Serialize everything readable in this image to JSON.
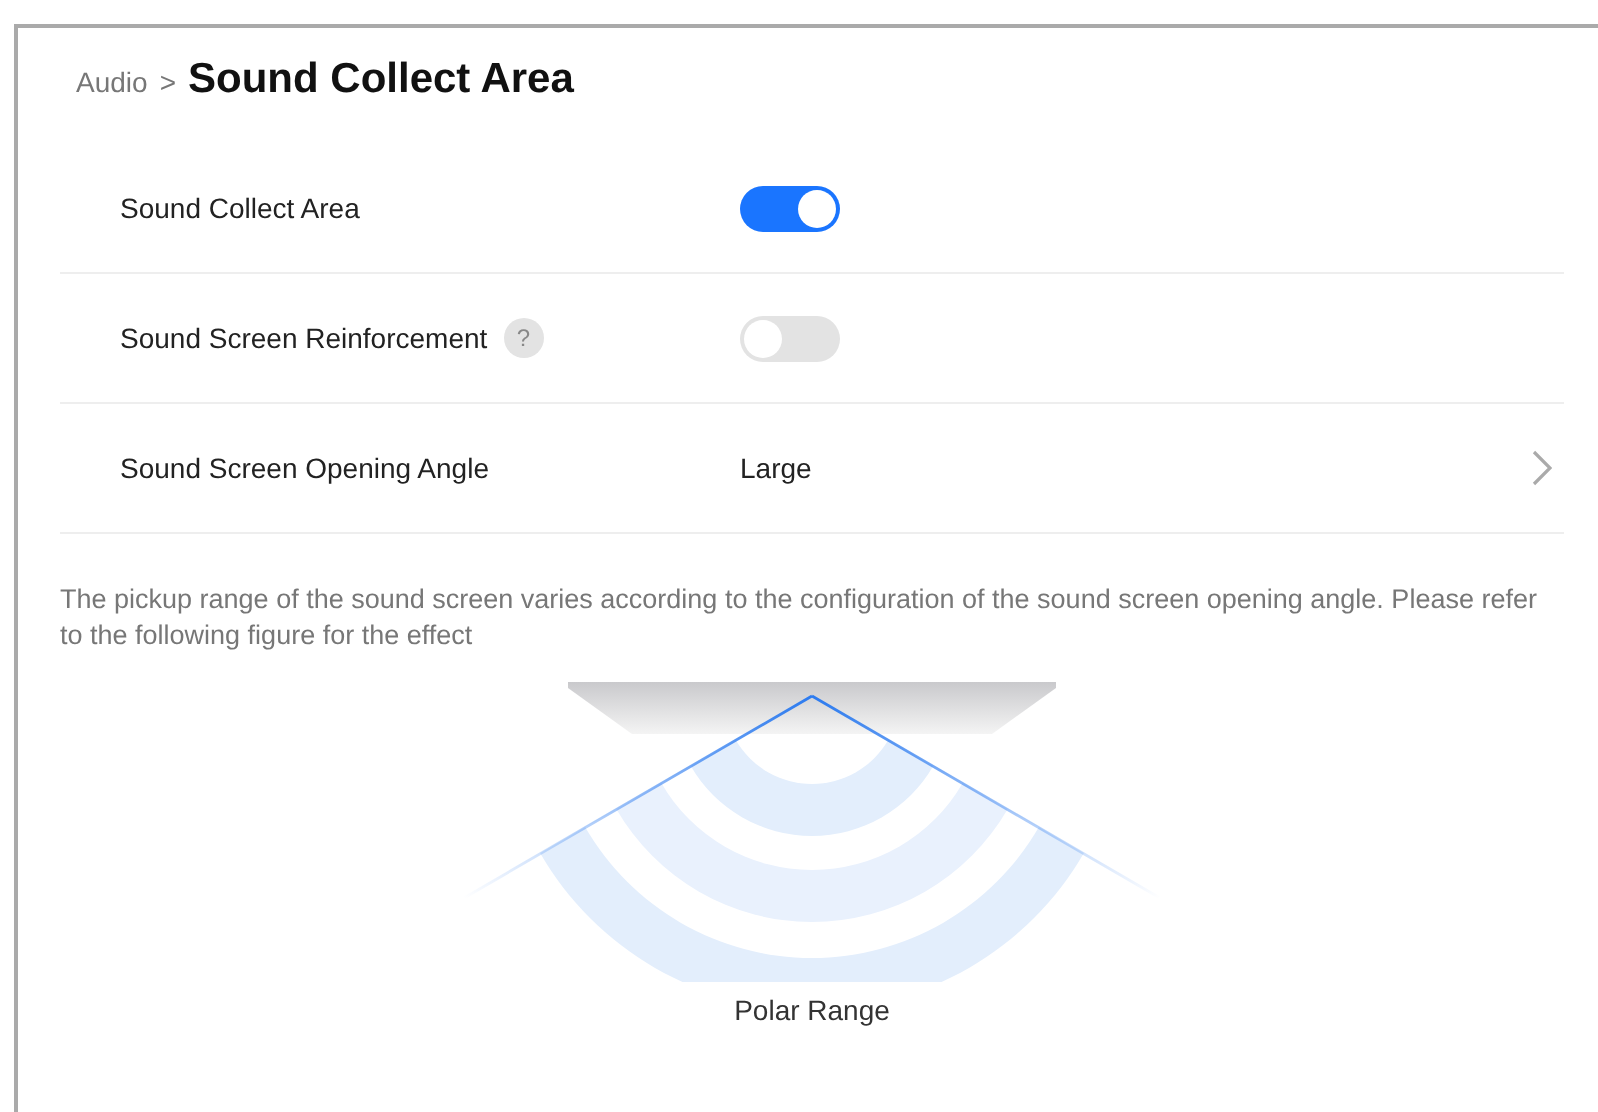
{
  "breadcrumb": {
    "parent": "Audio",
    "separator": ">",
    "title": "Sound Collect Area"
  },
  "settings": [
    {
      "kind": "toggle",
      "label": "Sound Collect Area",
      "on": true
    },
    {
      "kind": "toggle",
      "label": "Sound Screen Reinforcement",
      "help_text": "?",
      "on": false
    },
    {
      "kind": "select",
      "label": "Sound Screen Opening Angle",
      "value": "Large"
    }
  ],
  "description": "The pickup range of the sound screen varies according to the configuration of the sound screen opening angle. Please refer to the following figure for the effect",
  "figure": {
    "caption": "Polar Range"
  }
}
